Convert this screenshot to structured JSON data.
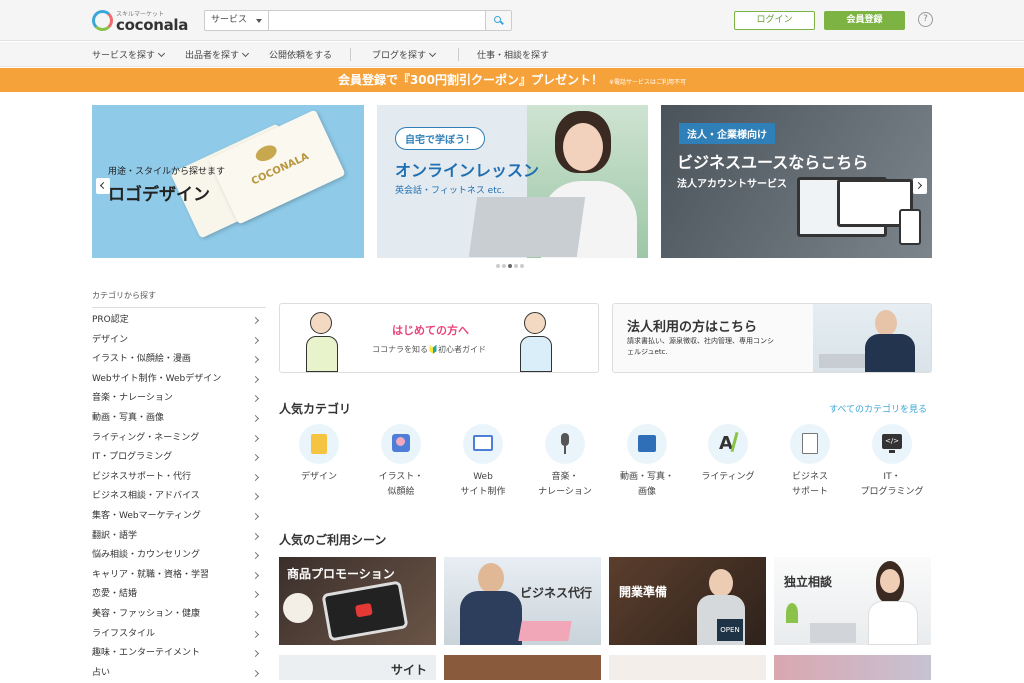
{
  "header": {
    "logo_sub": "スキルマーケット",
    "logo_name": "coconala",
    "search_select": "サービス",
    "search_placeholder": "",
    "login_label": "ログイン",
    "register_label": "会員登録",
    "help_label": "?"
  },
  "nav": {
    "items": [
      "サービスを探す",
      "出品者を探す",
      "公開依頼をする",
      "ブログを探す",
      "仕事・相談を探す"
    ]
  },
  "promo": {
    "text": "会員登録で『300円割引クーポン』プレゼント！",
    "note": "※電話サービスはご利用不可"
  },
  "banners": {
    "logo": {
      "sub": "用途・スタイルから探せます",
      "title": "ロゴデザイン",
      "card_text": "COCONALA"
    },
    "lesson": {
      "pill": "自宅で学ぼう！",
      "title": "オンラインレッスン",
      "sub": "英会話・フィットネス etc."
    },
    "business": {
      "tag": "法人・企業様向け",
      "title": "ビジネスユースならこちら",
      "sub": "法人アカウントサービス"
    }
  },
  "sidebar": {
    "heading": "カテゴリから探す",
    "items": [
      "PRO認定",
      "デザイン",
      "イラスト・似顔絵・漫画",
      "Webサイト制作・Webデザイン",
      "音楽・ナレーション",
      "動画・写真・画像",
      "ライティング・ネーミング",
      "IT・プログラミング",
      "ビジネスサポート・代行",
      "ビジネス相談・アドバイス",
      "集客・Webマーケティング",
      "翻訳・語学",
      "悩み相談・カウンセリング",
      "キャリア・就職・資格・学習",
      "恋愛・結婚",
      "美容・ファッション・健康",
      "ライフスタイル",
      "趣味・エンターテイメント",
      "占い"
    ]
  },
  "guide": {
    "title": "はじめての方へ",
    "sub": "ココナラを知る🔰初心者ガイド"
  },
  "corporate": {
    "title": "法人利用の方はこちら",
    "sub": "請求書払い、源泉徴収、社内管理、専用コンシェルジュetc."
  },
  "popular": {
    "title": "人気カテゴリ",
    "see_all": "すべてのカテゴリを見る",
    "categories": [
      {
        "l1": "デザイン",
        "l2": ""
      },
      {
        "l1": "イラスト・",
        "l2": "似顔絵"
      },
      {
        "l1": "Web",
        "l2": "サイト制作"
      },
      {
        "l1": "音楽・",
        "l2": "ナレーション"
      },
      {
        "l1": "動画・写真・",
        "l2": "画像"
      },
      {
        "l1": "ライティング",
        "l2": ""
      },
      {
        "l1": "ビジネス",
        "l2": "サポート"
      },
      {
        "l1": "IT・",
        "l2": "プログラミング"
      }
    ]
  },
  "scenes": {
    "title": "人気のご利用シーン",
    "items": [
      "商品プロモーション",
      "ビジネス代行",
      "開業準備",
      "独立相談"
    ],
    "row2_first": "サイト"
  },
  "colors": {
    "accent_green": "#7cb342",
    "promo_orange": "#f5a23b",
    "link_blue": "#3aa7d8"
  }
}
